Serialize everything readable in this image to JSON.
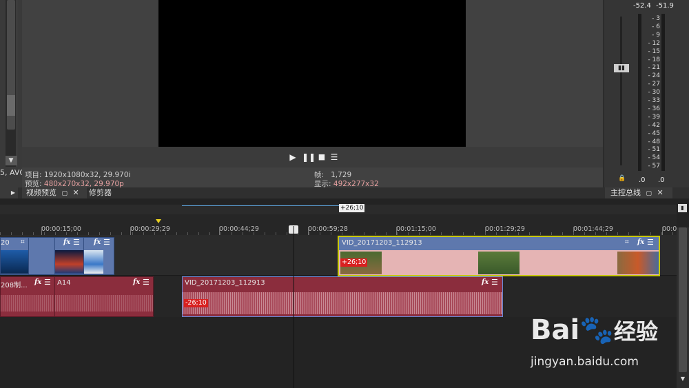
{
  "left_panel": {
    "truncated_label": "5, AVC"
  },
  "preview": {
    "project_label": "项目:",
    "project_value": "1920x1080x32, 29.970i",
    "preview_label": "预览:",
    "preview_value": "480x270x32, 29.970p",
    "frame_label": "帧:",
    "frame_value": "1,729",
    "display_label": "显示:",
    "display_value": "492x277x32"
  },
  "tabs": {
    "video_preview": "视频预览",
    "trimmer": "修剪器",
    "master_bus": "主控总线"
  },
  "meters": {
    "peak_left": "-52.4",
    "peak_right": "-51.9",
    "scale": [
      "3",
      "6",
      "9",
      "12",
      "15",
      "18",
      "21",
      "24",
      "27",
      "30",
      "33",
      "36",
      "39",
      "42",
      "45",
      "48",
      "51",
      "54",
      "57"
    ],
    "bottom_left": ".0",
    "bottom_right": ".0"
  },
  "ruler": {
    "timecodes": [
      "00:00:15;00",
      "00:00:29;29",
      "00:00:44;29",
      "00:00:59;28",
      "00:01:15;00",
      "00:01:29;29",
      "00:01:44;29",
      "00:0"
    ]
  },
  "selection_offset": "+26;10",
  "tracks": {
    "video_left_label": "20",
    "video_clip_right": "VID_20171203_112913",
    "video_offset_badge": "+26;10",
    "audio_left_label": "208制...",
    "audio_a14": "A14",
    "audio_clip_mid": "VID_20171203_112913",
    "audio_offset_badge": "-26;10"
  },
  "watermark": {
    "brand": "Bai",
    "brand2": "经验",
    "url": "jingyan.baidu.com"
  }
}
